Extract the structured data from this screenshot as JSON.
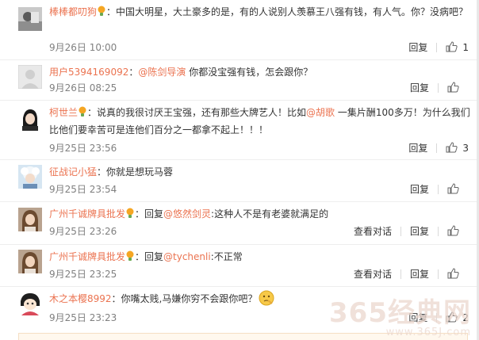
{
  "actions": {
    "reply": "回复",
    "view_chat": "查看对话"
  },
  "comments": [
    {
      "username": "棒棒都叨狗",
      "text": "：中国大明星，大土豪多的是，有的人说别人羡慕王八强有钱，有人气。你？没病吧？",
      "time": "9月26日 10:00",
      "likes": "1"
    },
    {
      "username": "用户5394169092",
      "prefix": "：",
      "mention": "@陈剑导演",
      "text": " 你都没宝强有钱，怎会跟你？",
      "time": "9月26日 08:25",
      "likes": ""
    },
    {
      "username": "柯世兰",
      "text_a": "：说真的我很讨厌王宝强，还有那些大牌艺人！比如",
      "mention": "@胡歌",
      "text_b": " 一集片酬100多万！为什么我们比他们要幸苦可是连他们百分之一都拿不起上！！！",
      "time": "9月25日 23:56",
      "likes": "3"
    },
    {
      "username": "征战记小猛",
      "text": "：你就是想玩马蓉",
      "time": "9月25日 23:54",
      "likes": ""
    },
    {
      "username": "广州千诚牌具批发",
      "prefix": "：回复",
      "mention": "@悠然剑灵",
      "text": ":这种人不是有老婆就满足的",
      "time": "9月25日 23:26",
      "likes": ""
    },
    {
      "username": "广州千诚牌具批发",
      "prefix": "：回复",
      "mention": "@tychenli",
      "text": ":不正常",
      "time": "9月25日 23:25",
      "likes": ""
    },
    {
      "username": "木之本樱8992",
      "text": "：你嘴太贱,马嫌你穷不会跟你吧？",
      "time": "9月25日 23:23",
      "likes": "2"
    }
  ],
  "watermark": {
    "main": "365经典网",
    "url": "www.365J.com"
  },
  "colors": {
    "link": "#eb7350",
    "time": "#808080",
    "text": "#333333",
    "divider": "#eeeeee"
  },
  "icons": {
    "like": "thumbs-up-icon",
    "badge": "lightbulb-badge-icon",
    "emoji": "thinking-face-emoji-icon"
  }
}
